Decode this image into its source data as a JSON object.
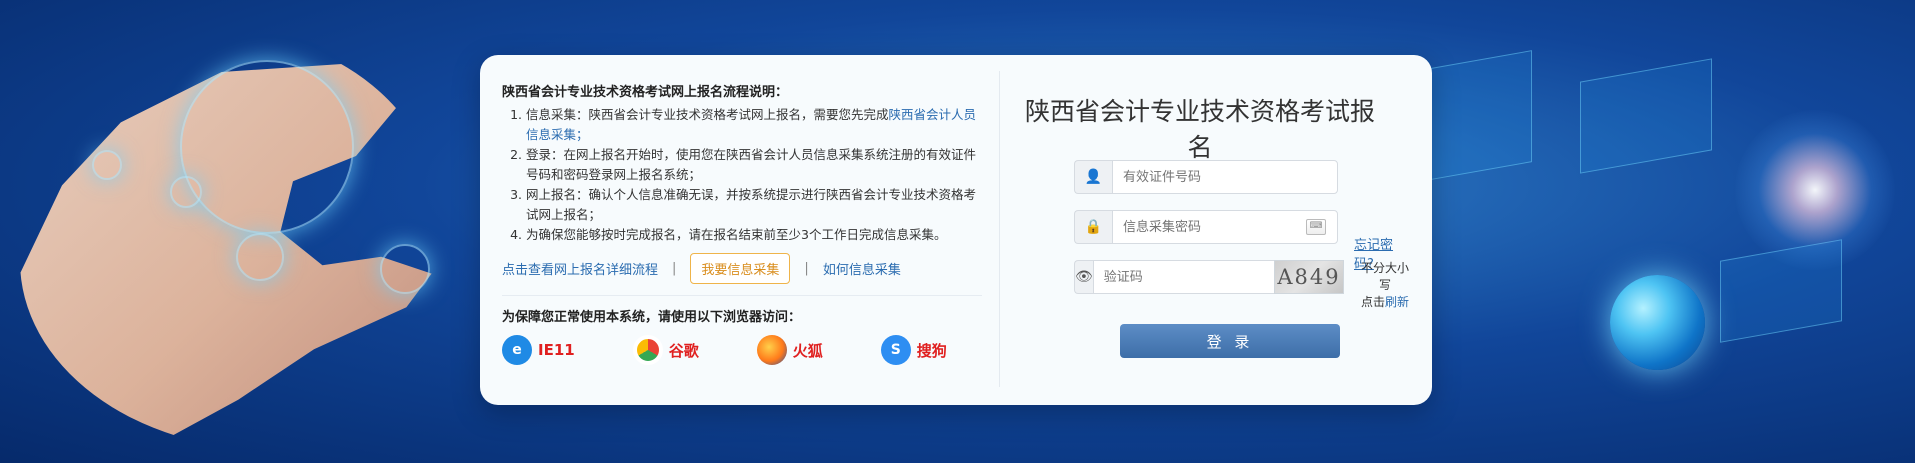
{
  "app": {
    "title": "陕西省会计专业技术资格考试报名"
  },
  "flow": {
    "heading": "陕西省会计专业技术资格考试网上报名流程说明：",
    "items": [
      {
        "text": "信息采集：陕西省会计专业技术资格考试网上报名，需要您先完成",
        "link": "陕西省会计人员信息采集；"
      },
      {
        "text": "登录：在网上报名开始时，使用您在陕西省会计人员信息采集系统注册的有效证件号码和密码登录网上报名系统；"
      },
      {
        "text": "网上报名：确认个人信息准确无误，并按系统提示进行陕西省会计专业技术资格考试网上报名；"
      },
      {
        "text": "为确保您能够按时完成报名，请在报名结束前至少3个工作日完成信息采集。"
      }
    ]
  },
  "actions": {
    "detail_link": "点击查看网上报名详细流程",
    "separator": "|",
    "collect_button": "我要信息采集",
    "how_link": "如何信息采集"
  },
  "browsers": {
    "note": "为保障您正常使用本系统，请使用以下浏览器访问：",
    "items": [
      {
        "name": "IE11",
        "icon": "ie-icon",
        "color": "#1f8ae5",
        "glyph": "e"
      },
      {
        "name": "谷歌",
        "icon": "chrome-icon",
        "color": "#f2b51a",
        "glyph": "●"
      },
      {
        "name": "火狐",
        "icon": "firefox-icon",
        "color": "#ff7a1a",
        "glyph": "🦊"
      },
      {
        "name": "搜狗",
        "icon": "sogou-icon",
        "color": "#2e8ef2",
        "glyph": "S"
      }
    ]
  },
  "login": {
    "id_placeholder": "有效证件号码",
    "password_placeholder": "信息采集密码",
    "captcha_placeholder": "验证码",
    "captcha_text": "A849",
    "forgot_link": "忘记密码?",
    "captcha_hint_line1": "不分大小写",
    "captcha_hint_prefix": "点击",
    "captcha_refresh": "刷新",
    "submit": "登 录"
  },
  "colors": {
    "accent": "#2b6cb0",
    "warning": "#d98d1d",
    "browser_text": "#e02020",
    "card_bg": "#f7fbfd",
    "login_btn": "#3d6ea8"
  }
}
